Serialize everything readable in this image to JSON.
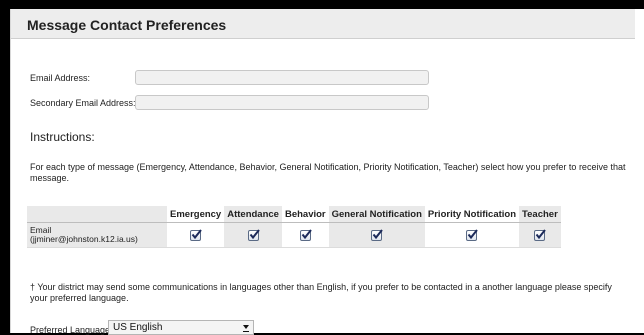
{
  "page": {
    "title": "Message Contact Preferences"
  },
  "fields": {
    "email_label": "Email Address:",
    "email_value": "",
    "secondary_email_label": "Secondary Email Address:",
    "secondary_email_value": ""
  },
  "instructions": {
    "heading": "Instructions:",
    "text": "For each type of message (Emergency, Attendance, Behavior, General Notification, Priority Notification, Teacher) select how you prefer to receive that message."
  },
  "preferences_table": {
    "columns": [
      "Emergency",
      "Attendance",
      "Behavior",
      "General Notification",
      "Priority Notification",
      "Teacher"
    ],
    "rows": [
      {
        "channel_line1": "Email",
        "channel_line2": "(jjminer@johnston.k12.ia.us)",
        "checked": [
          true,
          true,
          true,
          true,
          true,
          true
        ]
      }
    ]
  },
  "language_note": "† Your district may send some communications in languages other than English, if you prefer to be contacted in a another language please specify your preferred language.",
  "preferred_language": {
    "label": "Preferred Language",
    "selected": "US English"
  },
  "colors": {
    "header_bg": "#ededed",
    "row_shade": "#e9e9e9",
    "checkmark": "#1c2a5a"
  }
}
